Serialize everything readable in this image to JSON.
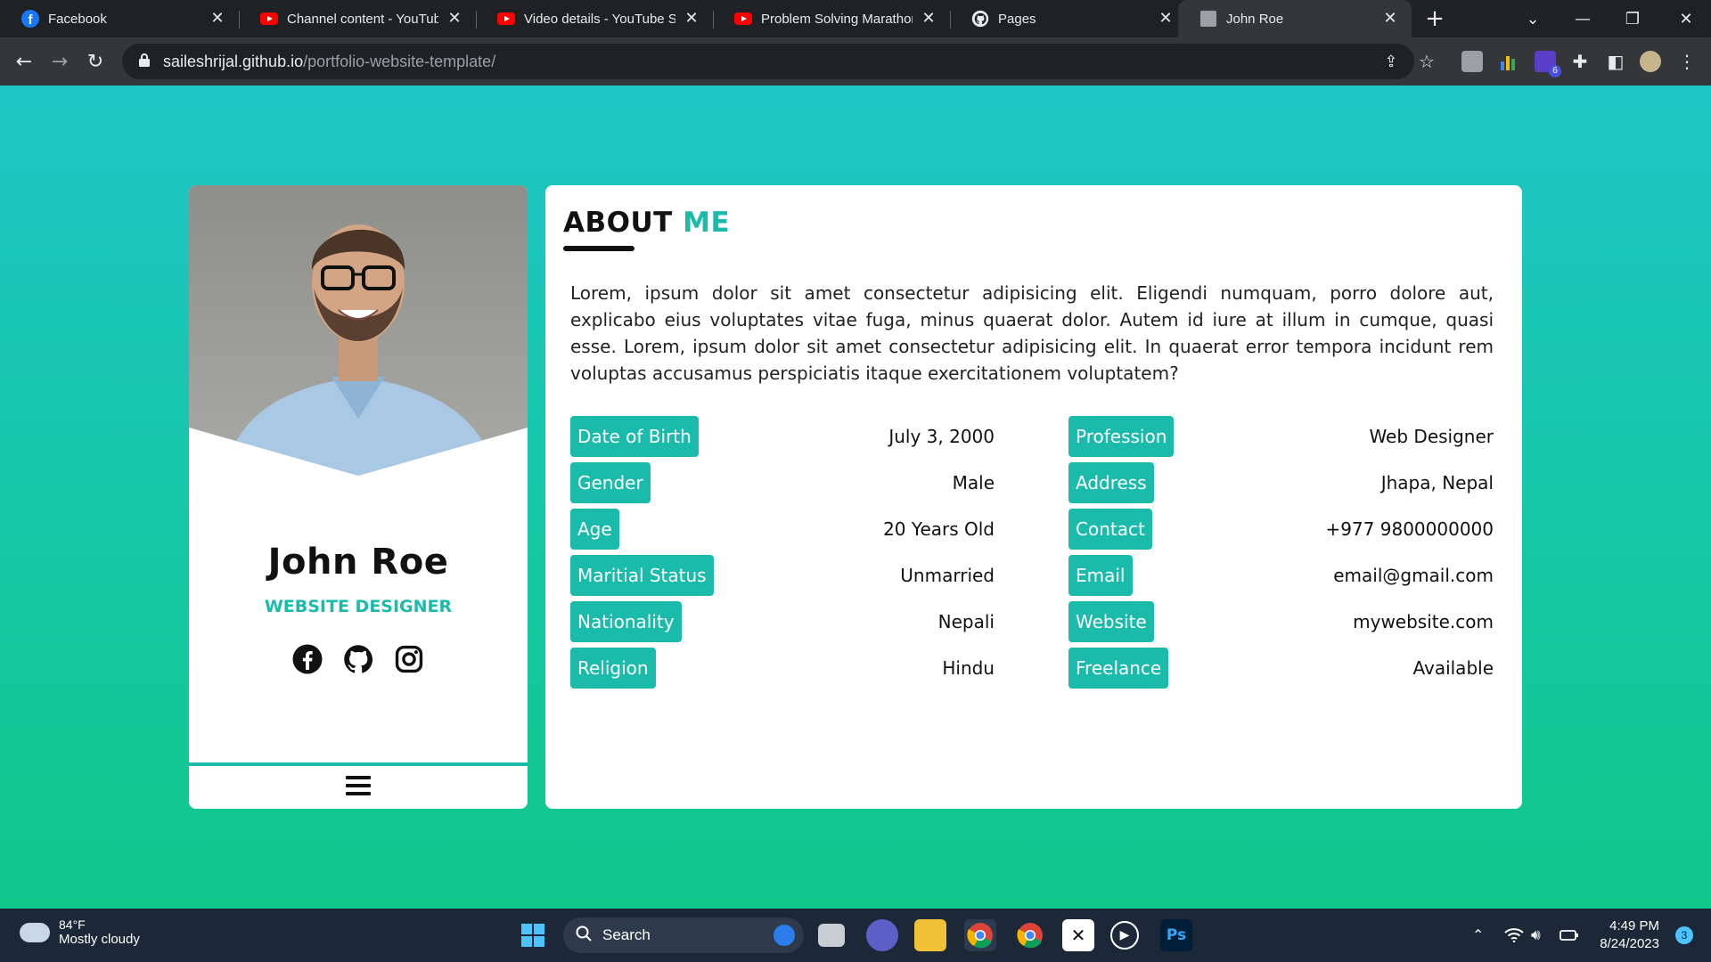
{
  "browser": {
    "tabs": [
      {
        "title": "Facebook",
        "icon": "facebook-icon"
      },
      {
        "title": "Channel content - YouTube",
        "icon": "youtube-icon"
      },
      {
        "title": "Video details - YouTube Stu",
        "icon": "youtube-icon"
      },
      {
        "title": "Problem Solving Marathon",
        "icon": "youtube-icon"
      },
      {
        "title": "Pages",
        "icon": "github-icon"
      },
      {
        "title": "John Roe",
        "icon": "page-icon",
        "active": true
      }
    ],
    "new_tab_label": "+",
    "url_host": "saileshrijal.github.io",
    "url_path": "/portfolio-website-template/",
    "extension_badge": "6"
  },
  "page": {
    "colors": {
      "accent": "#1bbbab",
      "gradient_top": "#1ec6c6",
      "gradient_bottom": "#11c78a"
    },
    "profile": {
      "name": "John Roe",
      "role": "WEBSITE DESIGNER",
      "socials": [
        "facebook-icon",
        "github-icon",
        "instagram-icon"
      ]
    },
    "about": {
      "title_main": "ABOUT",
      "title_accent": "ME",
      "paragraph": "Lorem, ipsum dolor sit amet consectetur adipisicing elit. Eligendi numquam, porro dolore aut, explicabo eius voluptates vitae fuga, minus quaerat dolor. Autem id iure at illum in cumque, quasi esse. Lorem, ipsum dolor sit amet consectetur adipisicing elit. In quaerat error tempora incidunt rem voluptas accusamus perspiciatis itaque exercitationem voluptatem?"
    },
    "info_left": [
      {
        "label": "Date of Birth",
        "value": "July 3, 2000"
      },
      {
        "label": "Gender",
        "value": "Male"
      },
      {
        "label": "Age",
        "value": "20 Years Old"
      },
      {
        "label": "Maritial Status",
        "value": "Unmarried"
      },
      {
        "label": "Nationality",
        "value": "Nepali"
      },
      {
        "label": "Religion",
        "value": "Hindu"
      }
    ],
    "info_right": [
      {
        "label": "Profession",
        "value": "Web Designer"
      },
      {
        "label": "Address",
        "value": "Jhapa, Nepal"
      },
      {
        "label": "Contact",
        "value": "+977 9800000000"
      },
      {
        "label": "Email",
        "value": "email@gmail.com"
      },
      {
        "label": "Website",
        "value": "mywebsite.com"
      },
      {
        "label": "Freelance",
        "value": "Available"
      }
    ]
  },
  "taskbar": {
    "weather_temp": "84°F",
    "weather_condition": "Mostly cloudy",
    "search_label": "Search",
    "time": "4:49 PM",
    "date": "8/24/2023",
    "notification_count": "3",
    "ps_label": "Ps"
  }
}
